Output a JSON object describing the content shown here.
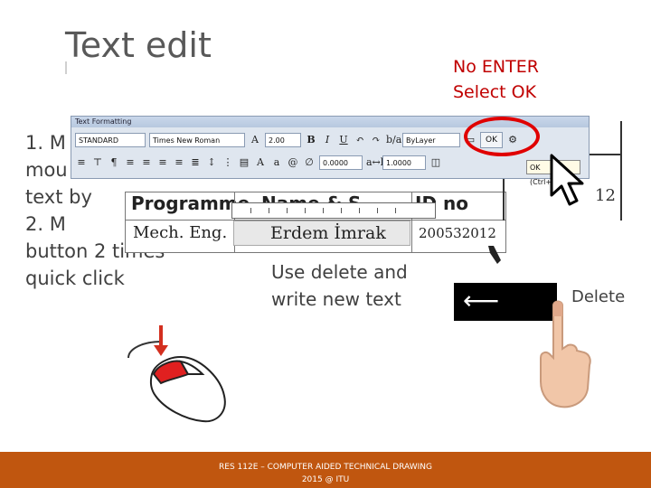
{
  "title": "Text edit",
  "red_note": [
    "No ENTER",
    "Select OK"
  ],
  "steps": [
    "1. M",
    "mou",
    "text",
    "2. M",
    "button 2 times",
    "quick click"
  ],
  "step_fragment": "by",
  "instruction": [
    "Use delete and",
    "write new text"
  ],
  "toolbar": {
    "title": "Text Formatting",
    "style": "STANDARD",
    "font": "Times New Roman",
    "height": "2.00",
    "bold": "B",
    "italic": "I",
    "underline": "U",
    "color": "ByLayer",
    "ok": "OK",
    "oblique": "0.0000",
    "tracking": "1.0000",
    "width": "1.0000"
  },
  "tooltip": "OK (Ctrl+Enter)",
  "table": {
    "headers": [
      "Programme",
      "Name & S",
      "ID no"
    ],
    "row": [
      "Mech. Eng.",
      "Erdem İmrak",
      "200532012"
    ],
    "right_num": "12"
  },
  "key": {
    "arrow": "⟵",
    "label": "Delete"
  },
  "footer": [
    "RES 112E – COMPUTER AIDED TECHNICAL DRAWING",
    "2015 @ ITU"
  ],
  "colors": {
    "footer": "#c0560f",
    "red": "#c00000",
    "text": "#404040"
  }
}
